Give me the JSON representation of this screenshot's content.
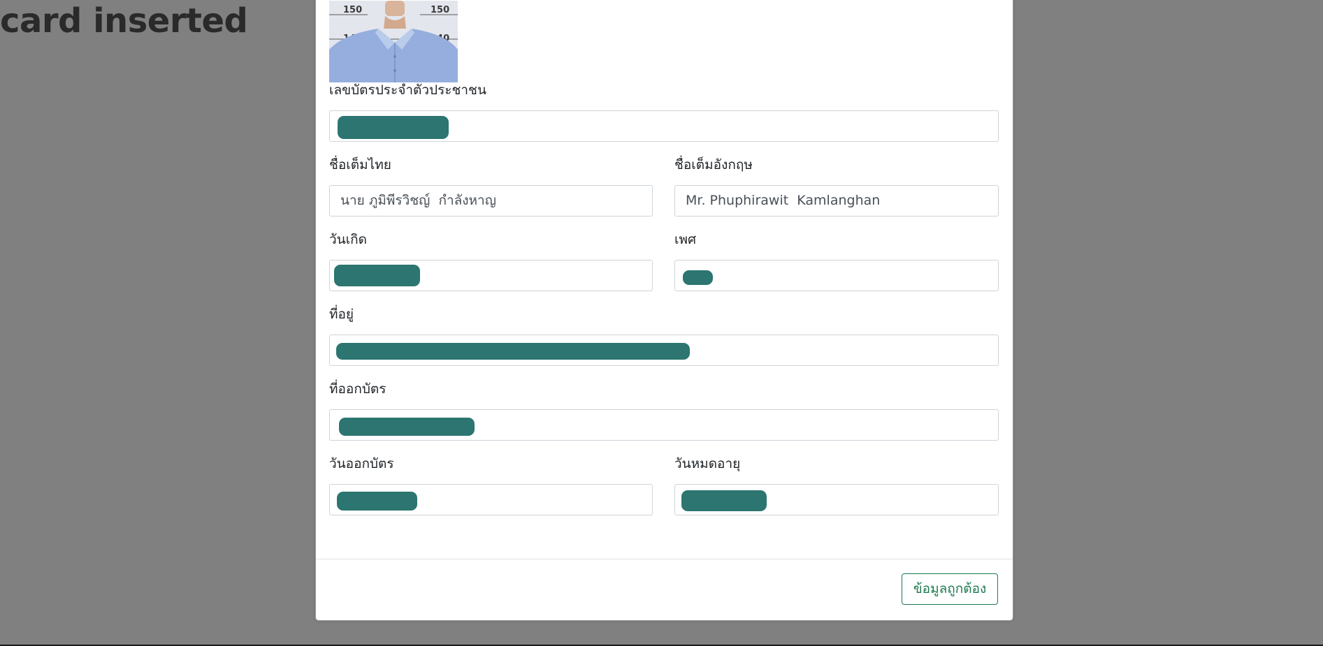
{
  "background": {
    "title": "card inserted"
  },
  "photo": {
    "ruler_left_top": "150",
    "ruler_right_top": "150",
    "ruler_left_bottom": "140",
    "ruler_right_bottom": "140"
  },
  "form": {
    "id_number": {
      "label": "เลขบัตรประจำตัวประชาชน",
      "value": ""
    },
    "fullname_th": {
      "label": "ชื่อเต็มไทย",
      "value": "นาย ภูมิพีรวิชญ์  กำลังหาญ"
    },
    "fullname_en": {
      "label": "ชื่อเต็มอังกฤษ",
      "value": "Mr. Phuphirawit  Kamlanghan"
    },
    "birth_date": {
      "label": "วันเกิด",
      "value": ""
    },
    "gender": {
      "label": "เพศ",
      "value": ""
    },
    "address": {
      "label": "ที่อยู่",
      "value": ""
    },
    "issuer": {
      "label": "ที่ออกบัตร",
      "value": ""
    },
    "issue_date": {
      "label": "วันออกบัตร",
      "value": ""
    },
    "expiry_date": {
      "label": "วันหมดอายุ",
      "value": ""
    }
  },
  "footer": {
    "confirm_label": "ข้อมูลถูกต้อง"
  },
  "colors": {
    "overlay": "#808080",
    "redaction": "#2c7570",
    "confirm_accent": "#1f7a4f"
  }
}
